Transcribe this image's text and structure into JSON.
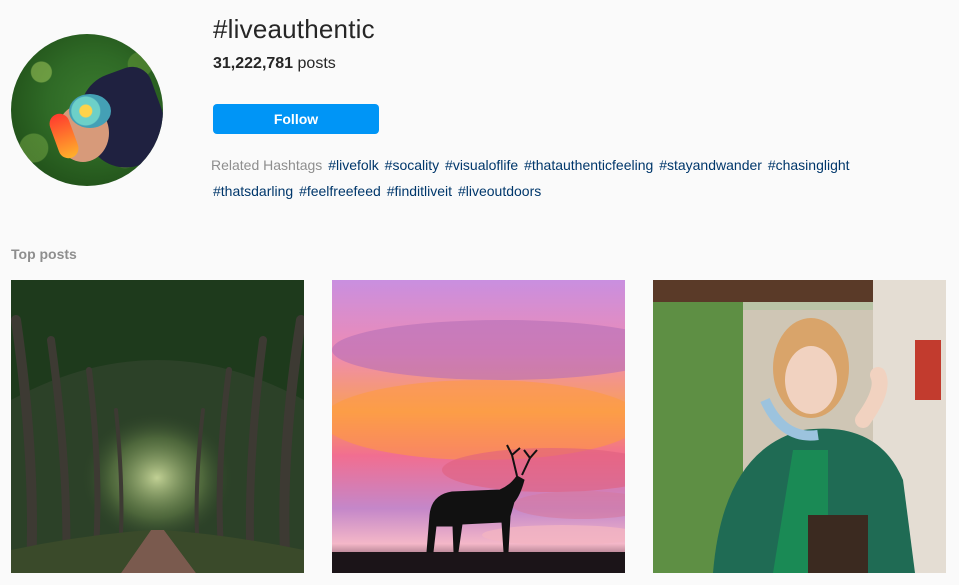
{
  "hashtag": {
    "title": "#liveauthentic",
    "post_count": "31,222,781",
    "posts_label": "posts"
  },
  "follow_label": "Follow",
  "related": {
    "label": "Related Hashtags",
    "tags": [
      "#livefolk",
      "#socality",
      "#visualoflife",
      "#thatauthenticfeeling",
      "#stayandwander",
      "#chasinglight",
      "#thatsdarling",
      "#feelfreefeed",
      "#finditliveit",
      "#liveoutdoors"
    ]
  },
  "top_posts_label": "Top posts",
  "colors": {
    "accent": "#0095f6",
    "hashtag_link": "#00376b",
    "muted_text": "#8e8e8e"
  }
}
